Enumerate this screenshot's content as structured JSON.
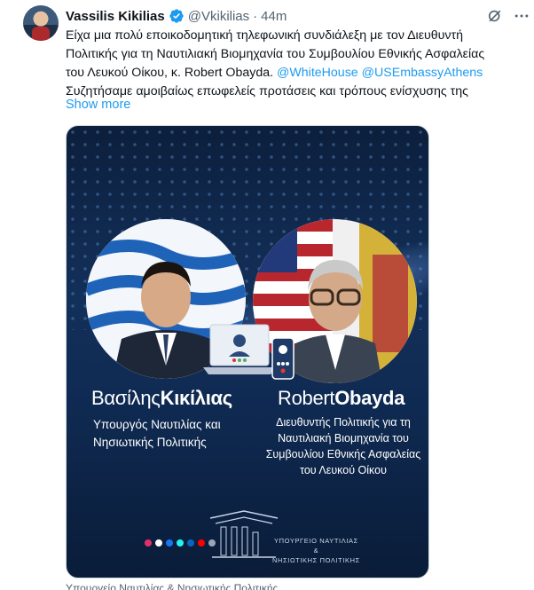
{
  "tweet": {
    "author_name": "Vassilis Kikilias",
    "author_handle": "@Vkikilias",
    "separator": "·",
    "time": "44m",
    "text_lines": [
      "Είχα μια πολύ εποικοδομητική τηλεφωνική συνδιάλεξη με τον Διευθυντή",
      "Πολιτικής για τη Ναυτιλιακή Βιομηχανία του Συμβουλίου Εθνικής Ασφαλείας"
    ],
    "text_line3_prefix": "του Λευκού Οίκου, κ. Robert Obayda. ",
    "mention_1": "@WhiteHouse",
    "mention_2": "@USEmbassyAthens",
    "text_line4": "Συζητήσαμε αμοιβαίως επωφελείς προτάσεις και τρόπους ενίσχυσης της",
    "show_more": "Show more",
    "media_caption": "Υπουργείο Ναυτιλίας & Νησιωτικής Πολιτικής"
  },
  "media": {
    "left_first": "Βασίλης",
    "left_last": "Κικίλιας",
    "left_role": "Υπουργός Ναυτιλίας και Νησιωτικής Πολιτικής",
    "right_first": "Robert",
    "right_last": "Obayda",
    "right_role": "Διευθυντής Πολιτικής για τη Ναυτιλιακή Βιομηχανία του Συμβουλίου Εθνικής Ασφαλείας του Λευκού Οίκου",
    "ministry_line1": "ΥΠΟΥΡΓΕΙΟ ΝΑΥΤΙΛΙΑΣ",
    "ministry_line2": "&",
    "ministry_line3": "ΝΗΣΙΩΤΙΚΗΣ ΠΟΛΙΤΙΚΗΣ"
  },
  "colors": {
    "link": "#1d9bf0",
    "verified": "#1d9bf0",
    "muted": "#536471",
    "card_bg": "#0f2a52"
  },
  "icons": [
    "verified-badge-icon",
    "grok-icon",
    "more-options-icon",
    "laptop-video-call-icon",
    "phone-video-call-icon",
    "ministry-logo-icon"
  ]
}
